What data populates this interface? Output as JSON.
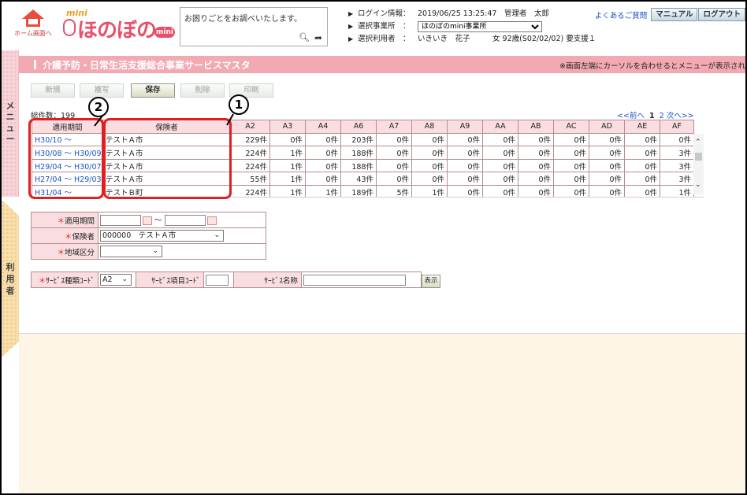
{
  "header": {
    "home_label": "ホーム画面へ",
    "logo_mini_top": "mini",
    "logo_name": "ほのぼの",
    "logo_badge": "mini",
    "search_placeholder": "お困りごとをお調べいたします。",
    "login_label": "ログイン情報：",
    "login_value": "2019/06/25 13:25:47　管理者　太郎",
    "office_label": "選択事業所　：",
    "office_value": "ほのぼのmini事業所",
    "user_label": "選択利用者　：",
    "user_value": "いきいき　花子　　　女 92歳(S02/02/02) 要支援１",
    "faq_link": "よくあるご質問",
    "manual_button": "マニュアル",
    "logout_button": "ログアウト"
  },
  "side": {
    "menu_tab": "メニュー",
    "user_tab": "利用者"
  },
  "title_bar": {
    "title": "介護予防・日常生活支援総合事業サービスマスタ",
    "note": "※画面左端にカーソルを合わせるとメニューが表示され"
  },
  "toolbar": {
    "new": "新規",
    "copy": "複写",
    "save": "保存",
    "delete": "削除",
    "print": "印刷"
  },
  "list": {
    "total_label": "総件数：",
    "total_value": "199",
    "pager_prev": "<<前へ",
    "pager_current": "1",
    "pager_next_page": "2",
    "pager_next": "次へ>>",
    "columns": [
      "適用期間",
      "保険者",
      "A2",
      "A3",
      "A4",
      "A6",
      "A7",
      "A8",
      "A9",
      "AA",
      "AB",
      "AC",
      "AD",
      "AE",
      "AF"
    ],
    "rows": [
      [
        "H30/10 ～",
        "テストＡ市",
        "229件",
        "0件",
        "0件",
        "203件",
        "0件",
        "0件",
        "0件",
        "0件",
        "0件",
        "0件",
        "0件",
        "0件",
        "0件"
      ],
      [
        "H30/08 ～ H30/09",
        "テストＡ市",
        "224件",
        "1件",
        "0件",
        "188件",
        "0件",
        "0件",
        "0件",
        "0件",
        "0件",
        "0件",
        "0件",
        "0件",
        "3件"
      ],
      [
        "H29/04 ～ H30/07",
        "テストＡ市",
        "224件",
        "1件",
        "0件",
        "188件",
        "0件",
        "0件",
        "0件",
        "0件",
        "0件",
        "0件",
        "0件",
        "0件",
        "3件"
      ],
      [
        "H27/04 ～ H29/03",
        "テストＡ市",
        "55件",
        "1件",
        "0件",
        "43件",
        "0件",
        "0件",
        "0件",
        "0件",
        "0件",
        "0件",
        "0件",
        "0件",
        "3件"
      ],
      [
        "H31/04 ～",
        "テストＢ町",
        "224件",
        "1件",
        "1件",
        "189件",
        "5件",
        "1件",
        "0件",
        "0件",
        "0件",
        "0件",
        "0件",
        "0件",
        "1件"
      ]
    ]
  },
  "annotations": {
    "badge_1": "1",
    "badge_2": "2"
  },
  "form": {
    "period_label": "適用期間",
    "period_sep": "～",
    "insurer_label": "保険者",
    "insurer_value": "000000　テストＡ市",
    "region_label": "地域区分",
    "region_value": "",
    "required_mark": "＊",
    "service_kind_label": "ｻｰﾋﾞｽ種類ｺｰﾄﾞ",
    "service_kind_value": "A2",
    "service_item_label": "ｻｰﾋﾞｽ項目ｺｰﾄﾞ",
    "service_name_label": "ｻｰﾋﾞｽ名称",
    "show_button": "表示"
  },
  "colors": {
    "title_bar": "#f3a9b1",
    "grid_header": "#f9dde0",
    "highlight": "#e02020",
    "link": "#1a53c5"
  }
}
